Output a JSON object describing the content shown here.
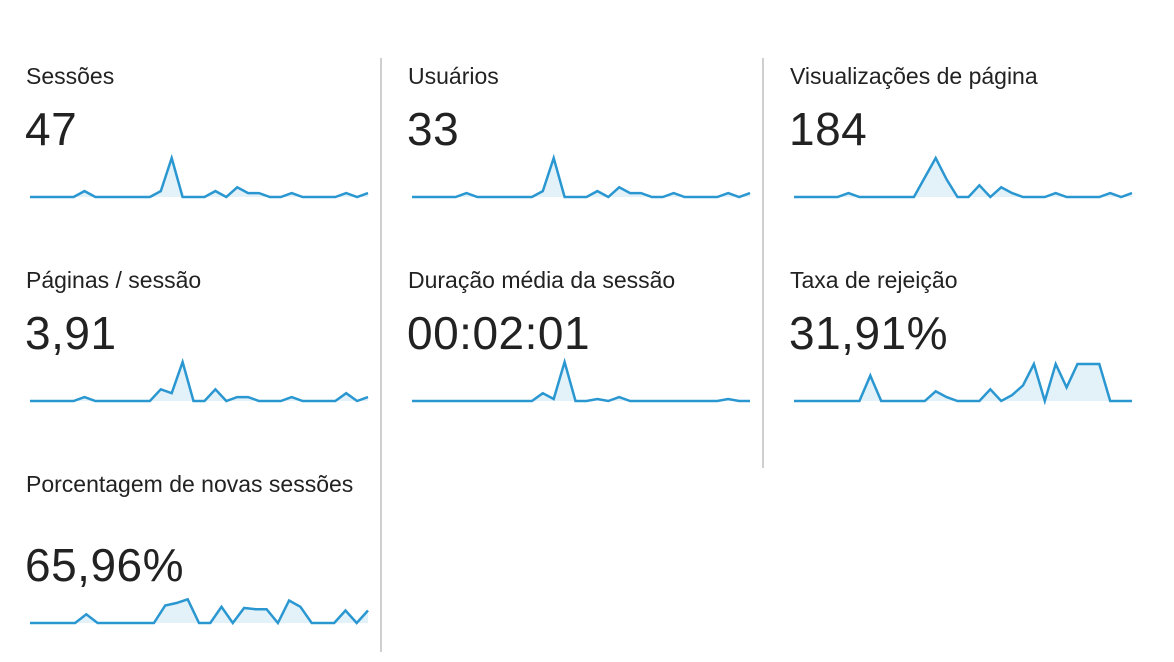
{
  "colors": {
    "line": "#2a97d1",
    "fill": "#e3f1f9",
    "divider": "#cfcfcf",
    "text": "#222222"
  },
  "metrics": [
    {
      "label": "Sessões",
      "value": "47",
      "sparkline": [
        0,
        0,
        0,
        0,
        0,
        0.15,
        0,
        0,
        0,
        0,
        0,
        0,
        0.15,
        1,
        0,
        0,
        0,
        0.15,
        0,
        0.25,
        0.1,
        0.1,
        0,
        0,
        0.1,
        0,
        0,
        0,
        0,
        0.1,
        0,
        0.1
      ]
    },
    {
      "label": "Usuários",
      "value": "33",
      "sparkline": [
        0,
        0,
        0,
        0,
        0,
        0.1,
        0,
        0,
        0,
        0,
        0,
        0,
        0.15,
        1,
        0,
        0,
        0,
        0.15,
        0,
        0.25,
        0.1,
        0.1,
        0,
        0,
        0.1,
        0,
        0,
        0,
        0,
        0.1,
        0,
        0.1
      ]
    },
    {
      "label": "Visualizações de página",
      "value": "184",
      "sparkline": [
        0,
        0,
        0,
        0,
        0,
        0.1,
        0,
        0,
        0,
        0,
        0,
        0,
        0.5,
        1,
        0.45,
        0,
        0,
        0.3,
        0,
        0.25,
        0.1,
        0,
        0,
        0,
        0.1,
        0,
        0,
        0,
        0,
        0.1,
        0,
        0.1
      ]
    },
    {
      "label": "Páginas / sessão",
      "value": "3,91",
      "sparkline": [
        0,
        0,
        0,
        0,
        0,
        0.1,
        0,
        0,
        0,
        0,
        0,
        0,
        0.3,
        0.2,
        1,
        0,
        0,
        0.3,
        0,
        0.1,
        0.1,
        0,
        0,
        0,
        0.1,
        0,
        0,
        0,
        0,
        0.2,
        0,
        0.1
      ]
    },
    {
      "label": "Duração média da sessão",
      "value": "00:02:01",
      "sparkline": [
        0,
        0,
        0,
        0,
        0,
        0,
        0,
        0,
        0,
        0,
        0,
        0,
        0.2,
        0.05,
        1,
        0,
        0,
        0.05,
        0,
        0.1,
        0,
        0,
        0,
        0,
        0,
        0,
        0,
        0,
        0,
        0.05,
        0,
        0
      ]
    },
    {
      "label": "Taxa de rejeição",
      "value": "31,91%",
      "sparkline": [
        0,
        0,
        0,
        0,
        0,
        0,
        0,
        0.65,
        0,
        0,
        0,
        0,
        0,
        0.25,
        0.1,
        0,
        0,
        0,
        0.3,
        0,
        0.15,
        0.4,
        0.95,
        0,
        0.95,
        0.35,
        0.95,
        0.95,
        0.95,
        0,
        0,
        0
      ]
    },
    {
      "label": "Porcentagem de novas sessões",
      "value": "65,96%",
      "sparkline": [
        0,
        0,
        0,
        0,
        0,
        0.35,
        0,
        0,
        0,
        0,
        0,
        0,
        0.7,
        0.8,
        0.95,
        0,
        0,
        0.65,
        0,
        0.6,
        0.55,
        0.55,
        0,
        0.9,
        0.65,
        0,
        0,
        0,
        0.5,
        0,
        0.5
      ]
    }
  ]
}
